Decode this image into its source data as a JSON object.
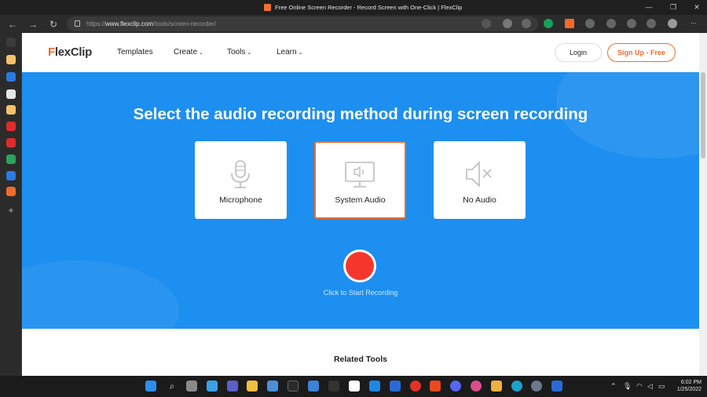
{
  "window": {
    "title": "Free Online Screen Recorder - Record Screen with One-Click | FlexClip",
    "controls": [
      "minimize",
      "restore",
      "close"
    ]
  },
  "browser": {
    "url_prefix": "https://",
    "url_host": "www.flexclip.com",
    "url_path": "/tools/screen-recorder/"
  },
  "site": {
    "logo": "FlexClip",
    "logo_accent": "F",
    "logo_rest": "lexClip",
    "nav": [
      {
        "label": "Templates"
      },
      {
        "label": "Create"
      },
      {
        "label": "Tools"
      },
      {
        "label": "Learn"
      }
    ],
    "login_label": "Login",
    "signup_label": "Sign Up - Free",
    "accent_color": "#f26b2a",
    "hero_color": "#1c8ff0"
  },
  "hero": {
    "title": "Select the audio recording method during screen recording",
    "options": [
      {
        "label": "Microphone",
        "icon": "microphone-icon",
        "selected": false
      },
      {
        "label": "System Audio",
        "icon": "monitor-speaker-icon",
        "selected": true
      },
      {
        "label": "No Audio",
        "icon": "speaker-muted-icon",
        "selected": false
      }
    ],
    "record_label": "Click to Start Recording"
  },
  "below": {
    "related_title": "Related Tools"
  },
  "taskbar": {
    "time": "6:02 PM",
    "date": "1/25/2022"
  }
}
